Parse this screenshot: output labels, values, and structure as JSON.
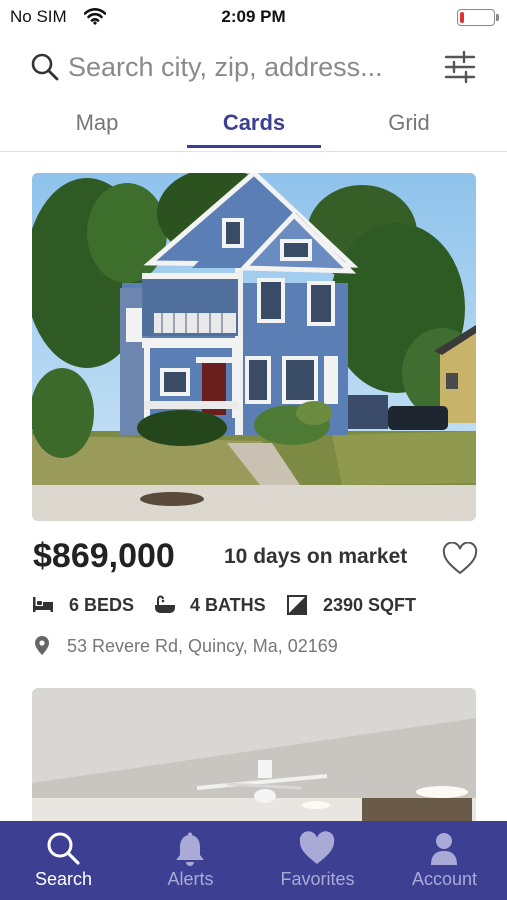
{
  "status_bar": {
    "carrier": "No SIM",
    "time": "2:09 PM",
    "battery_level": 0.12
  },
  "search": {
    "placeholder": "Search city, zip, address..."
  },
  "tabs": [
    {
      "label": "Map",
      "active": false
    },
    {
      "label": "Cards",
      "active": true
    },
    {
      "label": "Grid",
      "active": false
    }
  ],
  "listing": {
    "price": "$869,000",
    "days_on_market": "10 days on market",
    "beds": "6 BEDS",
    "baths": "4 BATHS",
    "sqft": "2390 SQFT",
    "address": "53 Revere Rd, Quincy, Ma, 02169"
  },
  "nav": [
    {
      "label": "Search",
      "icon": "search-icon",
      "active": true
    },
    {
      "label": "Alerts",
      "icon": "bell-icon",
      "active": false
    },
    {
      "label": "Favorites",
      "icon": "heart-icon",
      "active": false
    },
    {
      "label": "Account",
      "icon": "person-icon",
      "active": false
    }
  ],
  "colors": {
    "accent": "#3d3f93",
    "battery_low": "#e0312f",
    "nav_inactive": "#a9aad6"
  }
}
